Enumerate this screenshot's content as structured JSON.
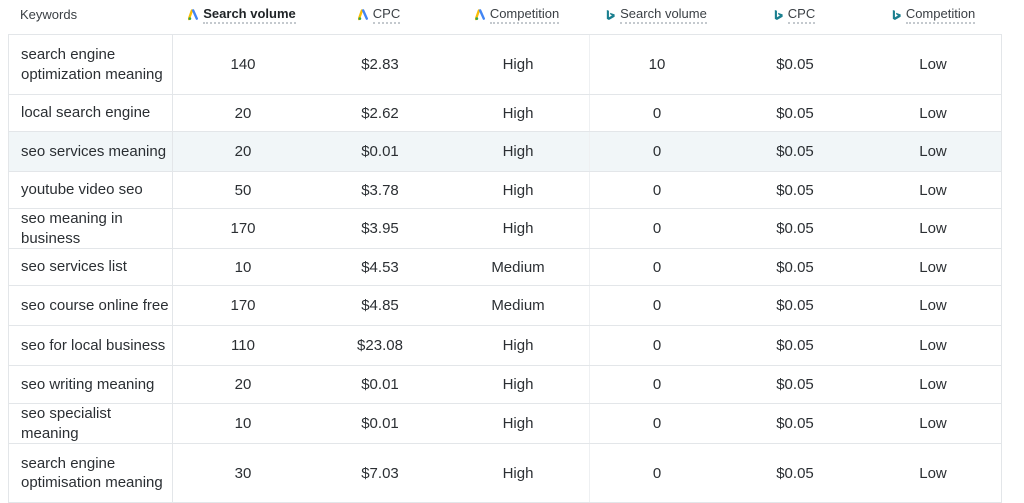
{
  "header": {
    "keywords": "Keywords",
    "google_search_volume": "Search volume",
    "google_cpc": "CPC",
    "google_competition": "Competition",
    "bing_search_volume": "Search volume",
    "bing_cpc": "CPC",
    "bing_competition": "Competition",
    "google_icon": "google-ads-icon",
    "bing_icon": "bing-icon",
    "google_icon_color": "#4285F4",
    "bing_icon_color": "#1a7f8f"
  },
  "rows": [
    {
      "keyword": "search engine optimization meaning",
      "g_sv": "140",
      "g_cpc": "$2.83",
      "g_comp": "High",
      "b_sv": "10",
      "b_cpc": "$0.05",
      "b_comp": "Low"
    },
    {
      "keyword": "local search engine",
      "g_sv": "20",
      "g_cpc": "$2.62",
      "g_comp": "High",
      "b_sv": "0",
      "b_cpc": "$0.05",
      "b_comp": "Low"
    },
    {
      "keyword": "seo services meaning",
      "g_sv": "20",
      "g_cpc": "$0.01",
      "g_comp": "High",
      "b_sv": "0",
      "b_cpc": "$0.05",
      "b_comp": "Low"
    },
    {
      "keyword": "youtube video seo",
      "g_sv": "50",
      "g_cpc": "$3.78",
      "g_comp": "High",
      "b_sv": "0",
      "b_cpc": "$0.05",
      "b_comp": "Low"
    },
    {
      "keyword": "seo meaning in business",
      "g_sv": "170",
      "g_cpc": "$3.95",
      "g_comp": "High",
      "b_sv": "0",
      "b_cpc": "$0.05",
      "b_comp": "Low"
    },
    {
      "keyword": "seo services list",
      "g_sv": "10",
      "g_cpc": "$4.53",
      "g_comp": "Medium",
      "b_sv": "0",
      "b_cpc": "$0.05",
      "b_comp": "Low"
    },
    {
      "keyword": "seo course online free",
      "g_sv": "170",
      "g_cpc": "$4.85",
      "g_comp": "Medium",
      "b_sv": "0",
      "b_cpc": "$0.05",
      "b_comp": "Low"
    },
    {
      "keyword": "seo for local business",
      "g_sv": "110",
      "g_cpc": "$23.08",
      "g_comp": "High",
      "b_sv": "0",
      "b_cpc": "$0.05",
      "b_comp": "Low"
    },
    {
      "keyword": "seo writing meaning",
      "g_sv": "20",
      "g_cpc": "$0.01",
      "g_comp": "High",
      "b_sv": "0",
      "b_cpc": "$0.05",
      "b_comp": "Low"
    },
    {
      "keyword": "seo specialist meaning",
      "g_sv": "10",
      "g_cpc": "$0.01",
      "g_comp": "High",
      "b_sv": "0",
      "b_cpc": "$0.05",
      "b_comp": "Low"
    },
    {
      "keyword": "search engine optimisation meaning",
      "g_sv": "30",
      "g_cpc": "$7.03",
      "g_comp": "High",
      "b_sv": "0",
      "b_cpc": "$0.05",
      "b_comp": "Low"
    }
  ]
}
